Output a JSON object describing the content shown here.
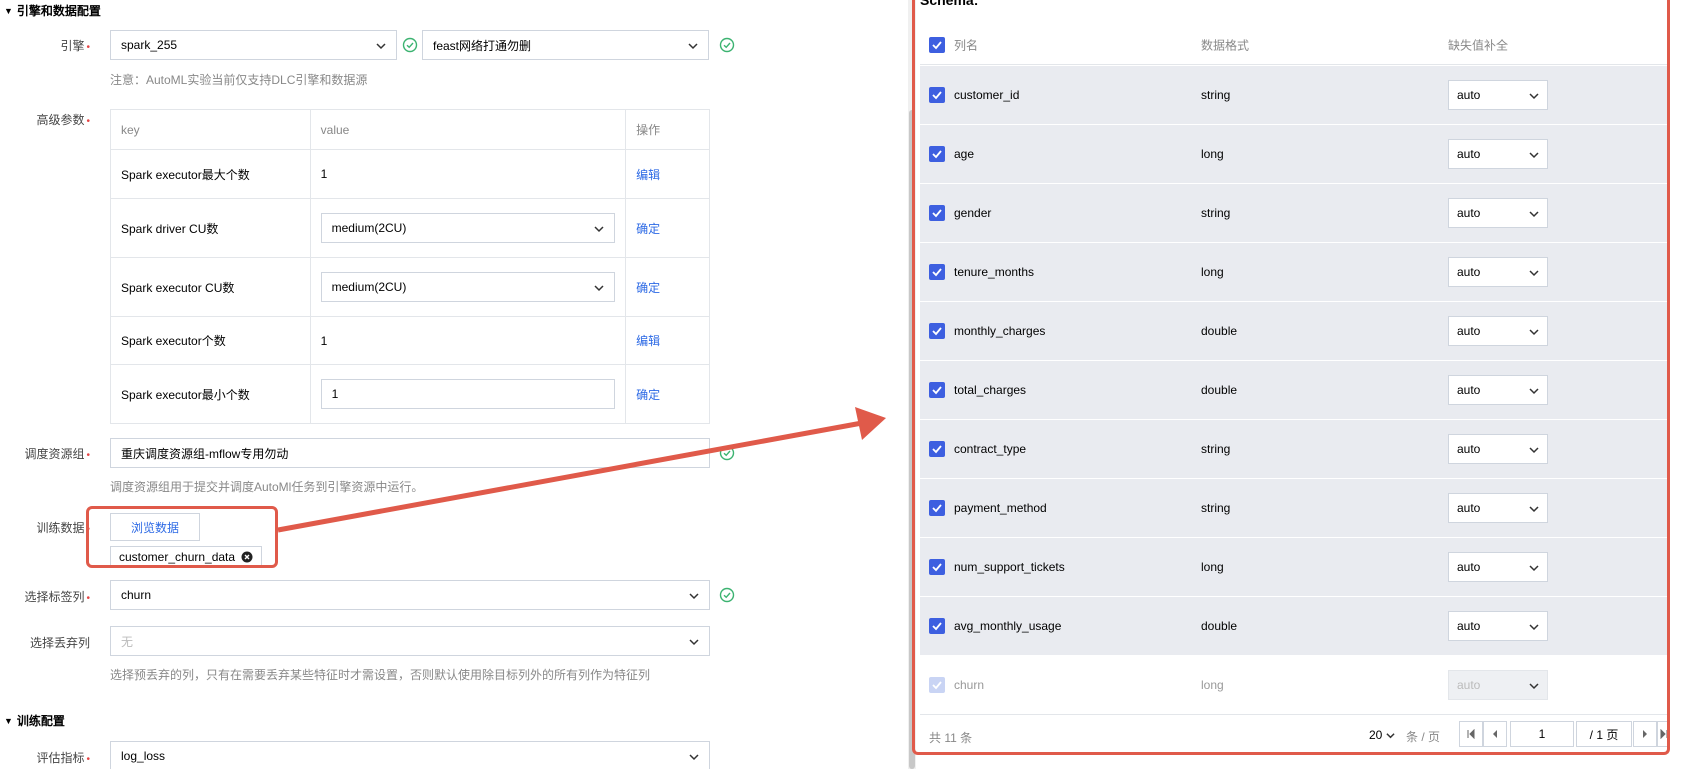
{
  "sections": {
    "engine_data": "引擎和数据配置",
    "training": "训练配置"
  },
  "engine": {
    "label": "引擎",
    "engine_value": "spark_255",
    "catalog_value": "feast网络打通勿删",
    "note": "注意：AutoML实验当前仅支持DLC引擎和数据源"
  },
  "advanced": {
    "label": "高级参数",
    "headers": [
      "key",
      "value",
      "操作"
    ],
    "rows": [
      {
        "key": "Spark executor最大个数",
        "value": "1",
        "action": "编辑"
      },
      {
        "key": "Spark driver CU数",
        "value": "medium(2CU)",
        "action": "确定"
      },
      {
        "key": "Spark executor CU数",
        "value": "medium(2CU)",
        "action": "确定"
      },
      {
        "key": "Spark executor个数",
        "value": "1",
        "action": "编辑"
      },
      {
        "key": "Spark executor最小个数",
        "value": "1",
        "action": "确定"
      }
    ]
  },
  "resource_group": {
    "label": "调度资源组",
    "value": "重庆调度资源组-mflow专用勿动",
    "hint": "调度资源组用于提交并调度AutoMl任务到引擎资源中运行。"
  },
  "training_data": {
    "label": "训练数据",
    "browse_label": "浏览数据",
    "tag": "customer_churn_data"
  },
  "label_column": {
    "label": "选择标签列",
    "value": "churn"
  },
  "drop_column": {
    "label": "选择丢弃列",
    "placeholder": "无",
    "hint": "选择预丢弃的列，只有在需要丢弃某些特征时才需设置，否则默认使用除目标列外的所有列作为特征列"
  },
  "metric": {
    "label": "评估指标",
    "value": "log_loss"
  },
  "schema": {
    "title": "Schema:",
    "headers": [
      "列名",
      "数据格式",
      "缺失值补全"
    ],
    "rows": [
      {
        "name": "customer_id",
        "type": "string",
        "fill": "auto"
      },
      {
        "name": "age",
        "type": "long",
        "fill": "auto"
      },
      {
        "name": "gender",
        "type": "string",
        "fill": "auto"
      },
      {
        "name": "tenure_months",
        "type": "long",
        "fill": "auto"
      },
      {
        "name": "monthly_charges",
        "type": "double",
        "fill": "auto"
      },
      {
        "name": "total_charges",
        "type": "double",
        "fill": "auto"
      },
      {
        "name": "contract_type",
        "type": "string",
        "fill": "auto"
      },
      {
        "name": "payment_method",
        "type": "string",
        "fill": "auto"
      },
      {
        "name": "num_support_tickets",
        "type": "long",
        "fill": "auto"
      },
      {
        "name": "avg_monthly_usage",
        "type": "double",
        "fill": "auto"
      },
      {
        "name": "churn",
        "type": "long",
        "fill": "auto"
      }
    ]
  },
  "pager": {
    "total": "共 11 条",
    "page_size": "20",
    "unit": "条 / 页",
    "page": "1",
    "of": "/ 1 页"
  },
  "colors": {
    "accent": "#2d6ae5",
    "checkbox": "#3d5fe0",
    "annotation": "#e05a4a",
    "success": "#3cb371",
    "required": "#e54545"
  }
}
